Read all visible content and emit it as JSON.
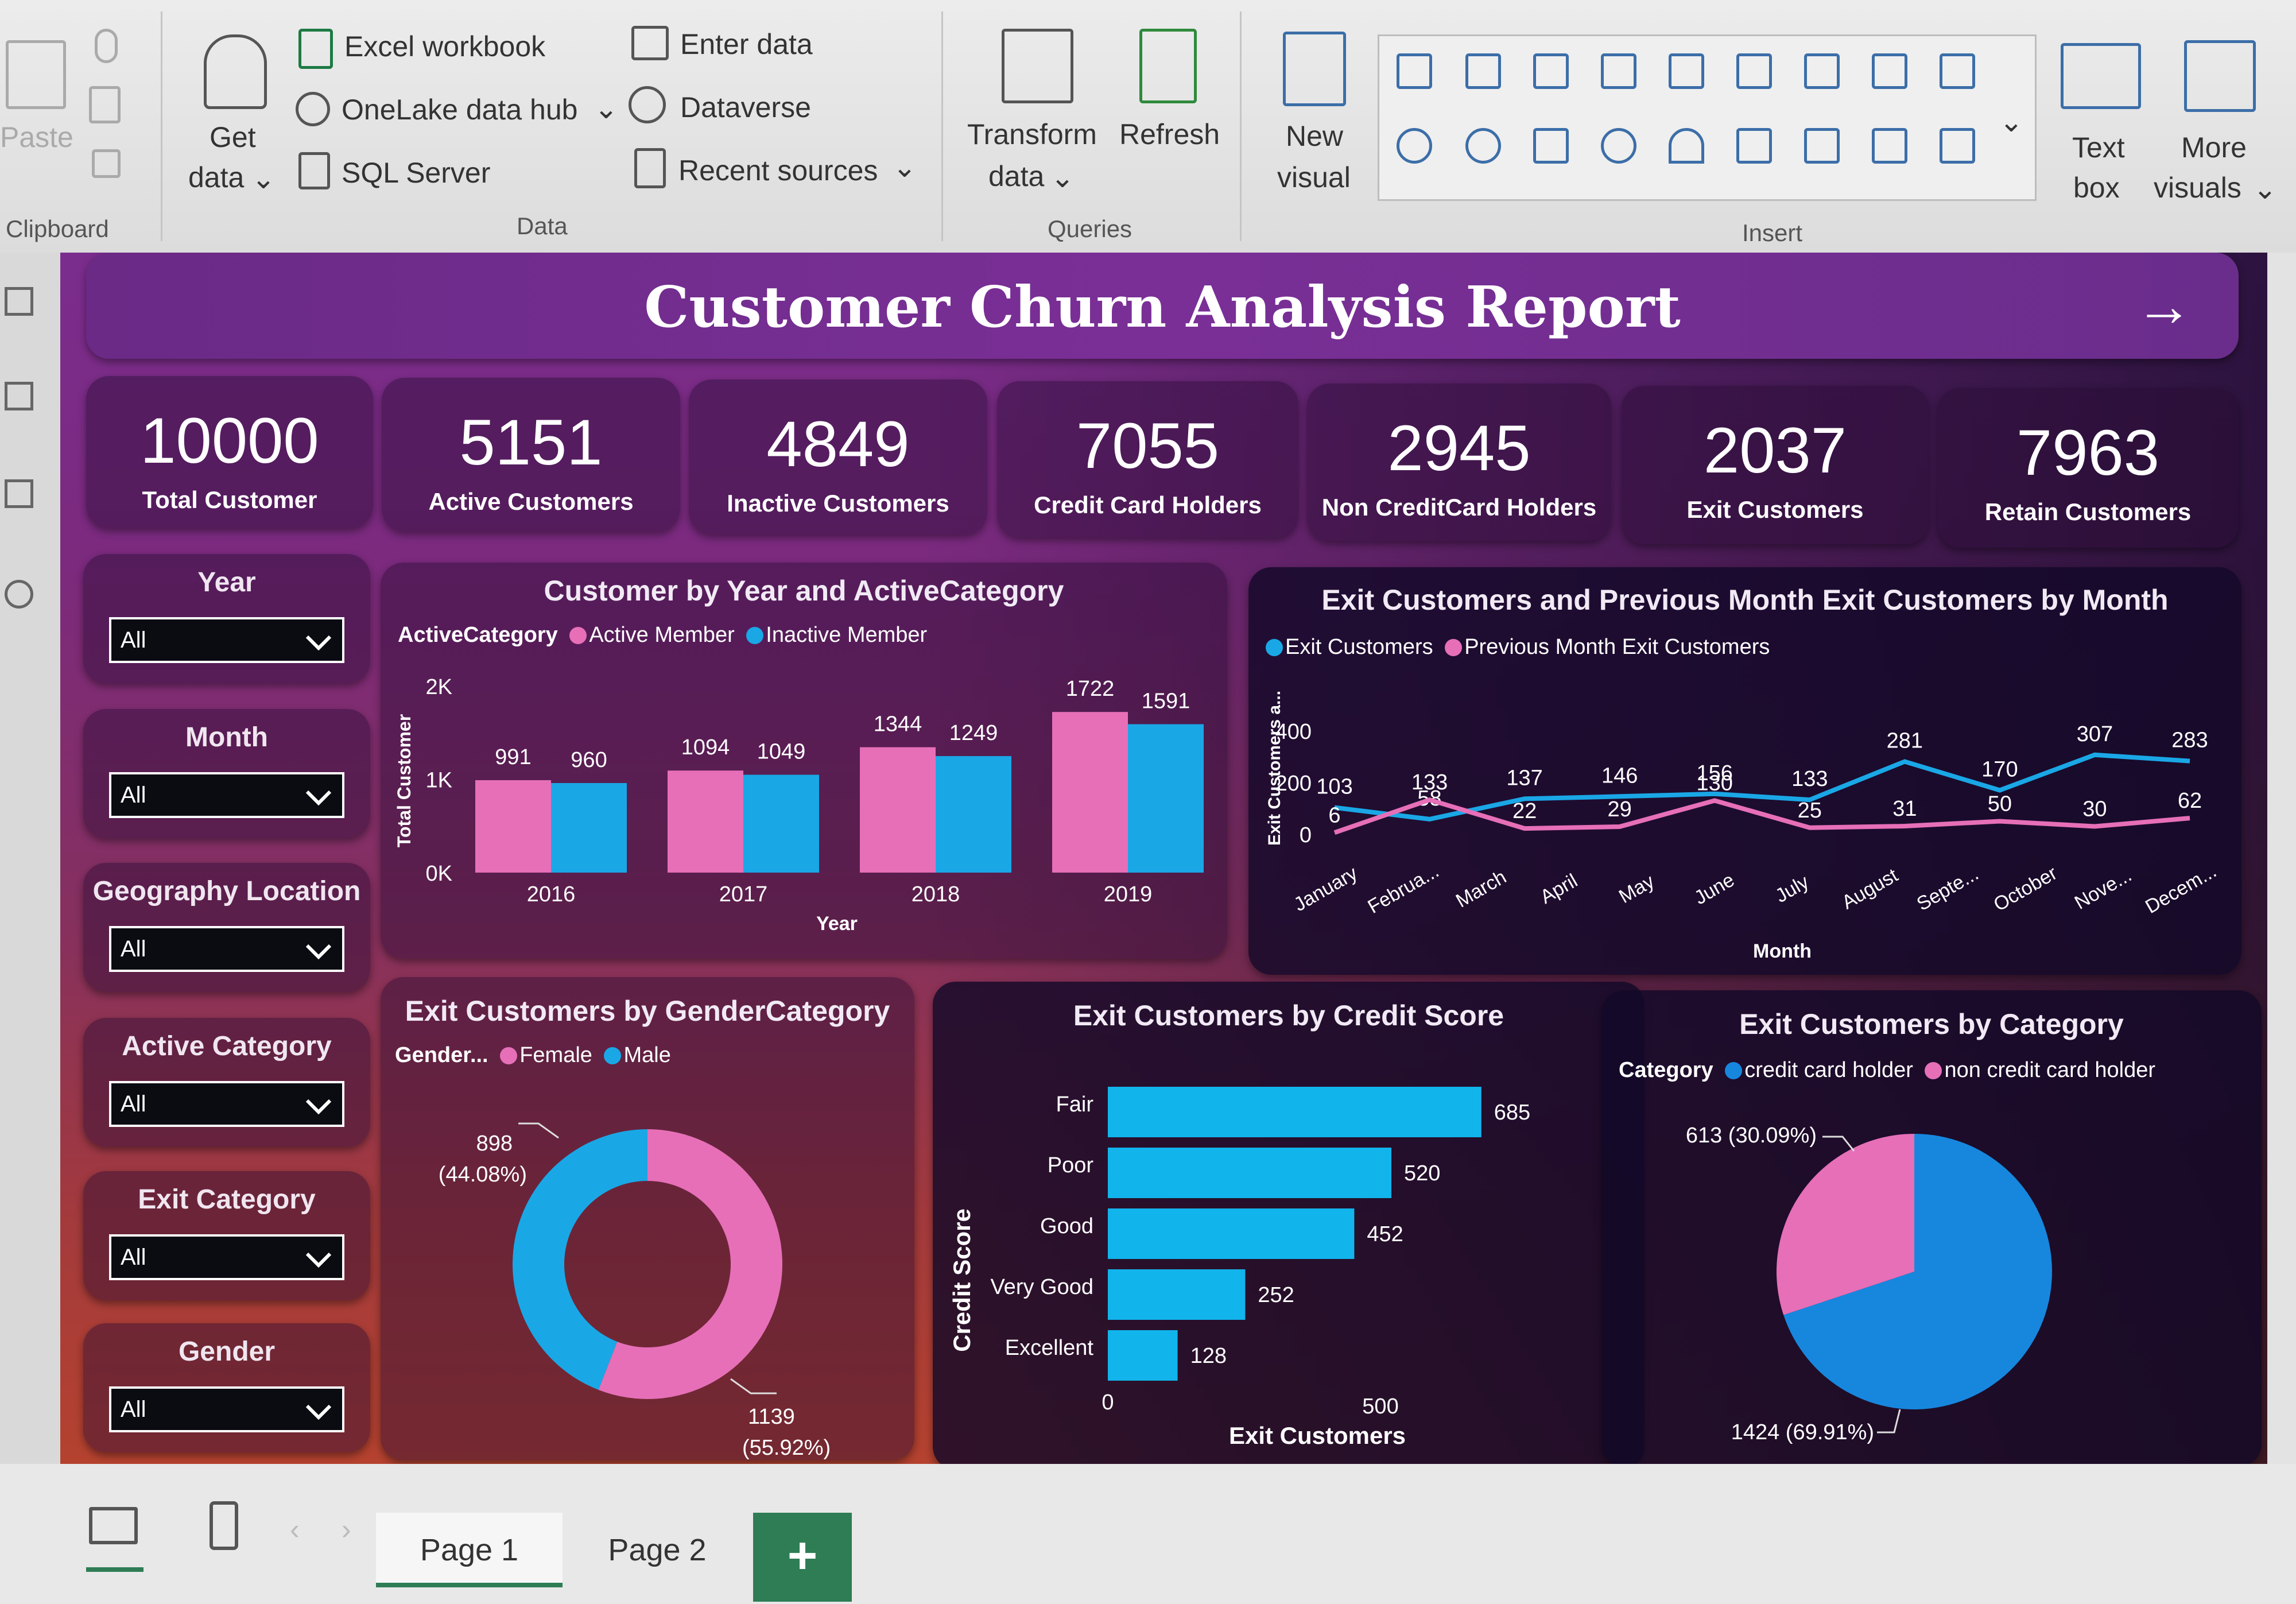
{
  "ribbon": {
    "paste": "Paste",
    "clipboard_section": "Clipboard",
    "get_data_line1": "Get",
    "get_data_line2": "data",
    "excel": "Excel workbook",
    "onelake": "OneLake data hub",
    "sql": "SQL Server",
    "enter_data": "Enter data",
    "dataverse": "Dataverse",
    "recent_sources": "Recent sources",
    "data_section": "Data",
    "transform_line1": "Transform",
    "transform_line2": "data",
    "refresh": "Refresh",
    "queries_section": "Queries",
    "new_visual_line1": "New",
    "new_visual_line2": "visual",
    "insert_section": "Insert",
    "text_box_line1": "Text",
    "text_box_line2": "box",
    "more_visuals_line1": "More",
    "more_visuals_line2": "visuals"
  },
  "report": {
    "title": "Customer Churn Analysis Report",
    "kpis": [
      {
        "value": "10000",
        "label": "Total Customer"
      },
      {
        "value": "5151",
        "label": "Active Customers"
      },
      {
        "value": "4849",
        "label": "Inactive Customers"
      },
      {
        "value": "7055",
        "label": "Credit Card Holders"
      },
      {
        "value": "2945",
        "label": "Non CreditCard Holders"
      },
      {
        "value": "2037",
        "label": "Exit Customers"
      },
      {
        "value": "7963",
        "label": "Retain Customers"
      }
    ],
    "slicers": [
      {
        "label": "Year",
        "value": "All"
      },
      {
        "label": "Month",
        "value": "All"
      },
      {
        "label": "Geography Location",
        "value": "All"
      },
      {
        "label": "Active Category",
        "value": "All"
      },
      {
        "label": "Exit Category",
        "value": "All"
      },
      {
        "label": "Gender",
        "value": "All"
      }
    ]
  },
  "colors": {
    "pink": "#e66fb8",
    "blue": "#1aa7e6",
    "bar_blue": "#12b4ec",
    "pie_blue": "#1787de"
  },
  "chart_data": [
    {
      "type": "bar",
      "title": "Customer by Year and ActiveCategory",
      "legend_title": "ActiveCategory",
      "xlabel": "Year",
      "ylabel": "Total Customer",
      "categories": [
        "2016",
        "2017",
        "2018",
        "2019"
      ],
      "series": [
        {
          "name": "Active Member",
          "values": [
            991,
            1094,
            1344,
            1722
          ]
        },
        {
          "name": "Inactive Member",
          "values": [
            960,
            1049,
            1249,
            1591
          ]
        }
      ],
      "yticks": [
        "0K",
        "1K",
        "2K"
      ],
      "ylim": [
        0,
        2000
      ]
    },
    {
      "type": "line",
      "title": "Exit Customers and Previous Month Exit Customers by Month",
      "xlabel": "Month",
      "ylabel": "Exit Customers a...",
      "categories": [
        "January",
        "Februa...",
        "March",
        "April",
        "May",
        "June",
        "July",
        "August",
        "Septe...",
        "October",
        "Nove...",
        "Decem..."
      ],
      "series": [
        {
          "name": "Exit Customers",
          "values": [
            103,
            58,
            137,
            146,
            156,
            133,
            281,
            170,
            307,
            283
          ]
        },
        {
          "name": "Previous Month Exit Customers",
          "values": [
            6,
            133,
            22,
            29,
            130,
            25,
            31,
            50,
            30,
            62
          ]
        }
      ],
      "yticks": [
        "0",
        "200",
        "400"
      ],
      "ylim": [
        0,
        400
      ]
    },
    {
      "type": "pie",
      "title": "Exit Customers by GenderCategory",
      "legend_title": "Gender...",
      "series": [
        {
          "name": "Female",
          "value": 1139,
          "label": "1139 (55.92%)"
        },
        {
          "name": "Male",
          "value": 898,
          "label": "898 (44.08%)"
        }
      ]
    },
    {
      "type": "bar",
      "title": "Exit Customers by Credit Score",
      "orientation": "horizontal",
      "xlabel": "Exit Customers",
      "ylabel": "Credit Score",
      "categories": [
        "Fair",
        "Poor",
        "Good",
        "Very Good",
        "Excellent"
      ],
      "values": [
        685,
        520,
        452,
        252,
        128
      ],
      "xticks": [
        "0",
        "500"
      ]
    },
    {
      "type": "pie",
      "title": "Exit Customers by Category",
      "legend_title": "Category",
      "series": [
        {
          "name": "credit card holder",
          "value": 1424,
          "label": "1424 (69.91%)"
        },
        {
          "name": "non credit card holder",
          "value": 613,
          "label": "613 (30.09%)"
        }
      ]
    }
  ],
  "pages": {
    "page1": "Page 1",
    "page2": "Page 2",
    "add": "+"
  }
}
